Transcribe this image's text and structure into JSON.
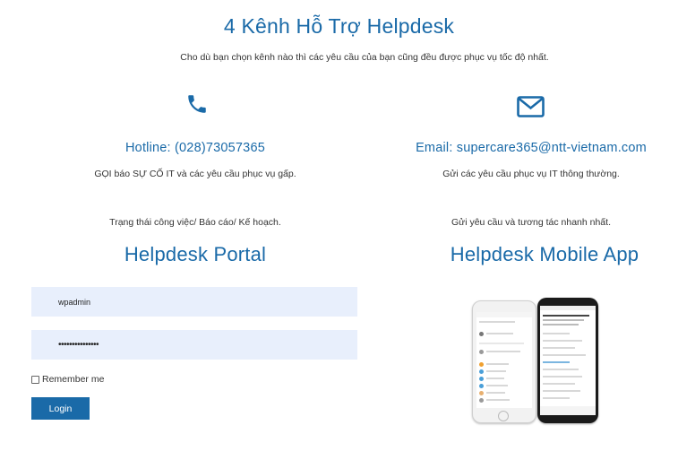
{
  "header": {
    "title": "4 Kênh Hỗ Trợ Helpdesk",
    "subtitle": "Cho dù bạn chọn kênh nào thì các yêu cầu của bạn cũng đều được phục vụ tốc độ nhất."
  },
  "channels": [
    {
      "icon": "phone-icon",
      "heading": "Hotline: (028)73057365",
      "description": "GỌI báo SỰ CỐ IT và các yêu cầu phục vụ gấp."
    },
    {
      "icon": "envelope-icon",
      "heading": "Email: supercare365@ntt-vietnam.com",
      "description": "Gửi các yêu cầu phục vụ IT thông thường."
    }
  ],
  "portal": {
    "description": "Trạng thái công việc/ Báo cáo/ Kế hoạch.",
    "title": "Helpdesk Portal",
    "username_value": "wpadmin",
    "password_value": "•••••••••••••••",
    "remember_label": "Remember me",
    "login_label": "Login"
  },
  "mobile": {
    "description": "Gửi yêu cầu và tương tác nhanh nhất.",
    "title": "Helpdesk Mobile App",
    "image_icon": "phones-image"
  },
  "colors": {
    "accent": "#1a6aa8",
    "input_bg": "#e8effc",
    "text": "#333333"
  }
}
